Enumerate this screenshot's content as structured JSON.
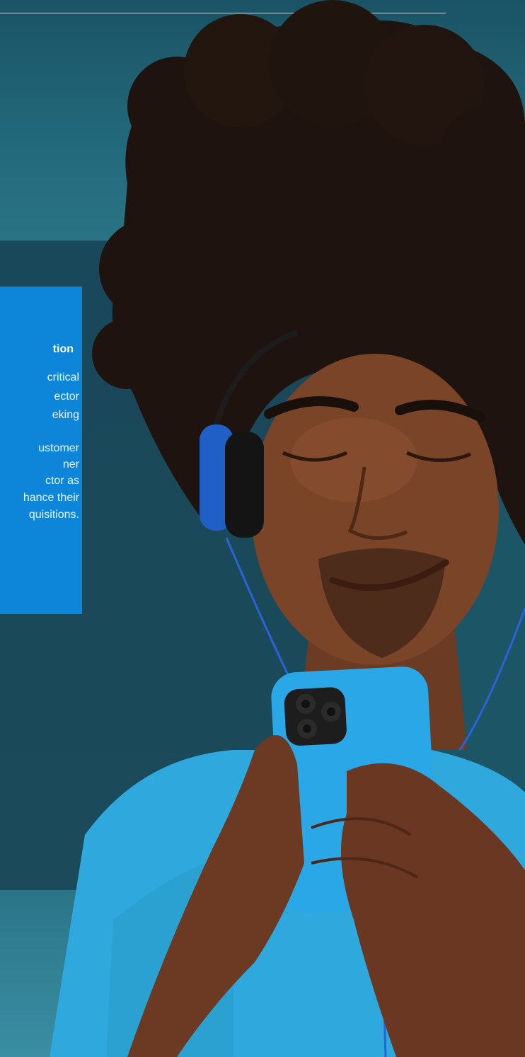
{
  "callout": {
    "heading": "tion",
    "lines": [
      "critical",
      "ector",
      "eking",
      "ustomer",
      "ner",
      "ctor as",
      "hance their",
      "quisitions."
    ]
  },
  "colors": {
    "accent_box": "#0d86d9",
    "background": "#1c5566",
    "phone_case": "#2aa7e6",
    "tshirt": "#2fa8dd"
  },
  "photo": {
    "subject": "person-with-headphones-and-phone"
  }
}
